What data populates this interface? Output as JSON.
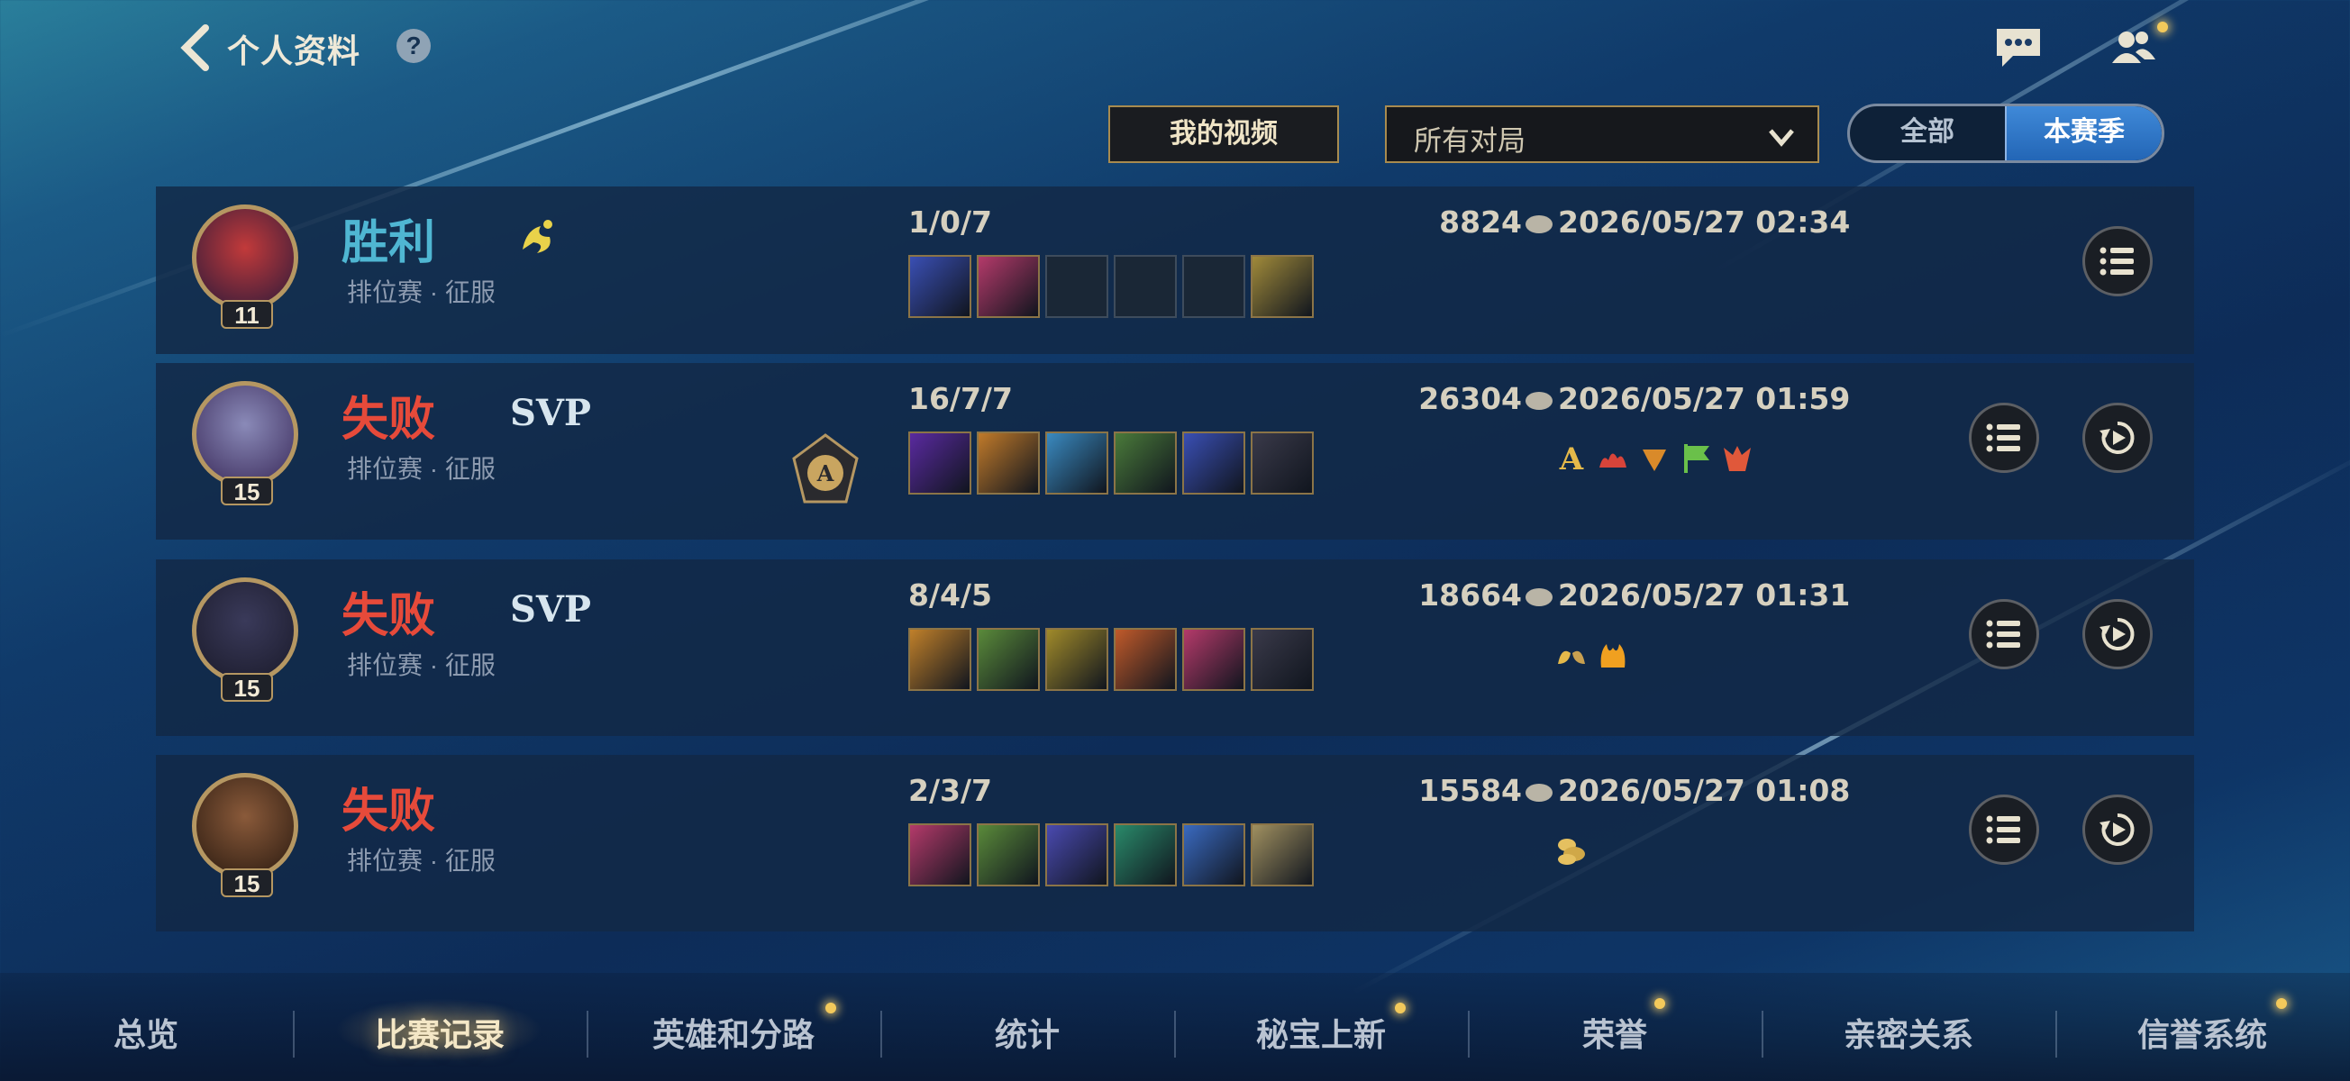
{
  "header": {
    "title": "个人资料",
    "help": "?"
  },
  "filters": {
    "my_video": "我的视频",
    "match_filter": "所有对局",
    "seg_all": "全部",
    "seg_season": "本赛季"
  },
  "matches": [
    {
      "level": "11",
      "result": "胜利",
      "mode": "排位赛 · 征服",
      "kda": "1/0/7",
      "gold": "8824",
      "date": "2026/05/27 02:34",
      "svp": ""
    },
    {
      "level": "15",
      "result": "失败",
      "mode": "排位赛 · 征服",
      "kda": "16/7/7",
      "gold": "26304",
      "date": "2026/05/27 01:59",
      "svp": "SVP"
    },
    {
      "level": "15",
      "result": "失败",
      "mode": "排位赛 · 征服",
      "kda": "8/4/5",
      "gold": "18664",
      "date": "2026/05/27 01:31",
      "svp": "SVP"
    },
    {
      "level": "15",
      "result": "失败",
      "mode": "排位赛 · 征服",
      "kda": "2/3/7",
      "gold": "15584",
      "date": "2026/05/27 01:08",
      "svp": ""
    }
  ],
  "nav": {
    "tabs": [
      "总览",
      "比赛记录",
      "英雄和分路",
      "统计",
      "秘宝上新",
      "荣誉",
      "亲密关系",
      "信誉系统"
    ],
    "active": "比赛记录"
  },
  "colors": {
    "win": "#4fb6d2",
    "lose": "#e64a3a",
    "gold_border": "#b59762"
  }
}
